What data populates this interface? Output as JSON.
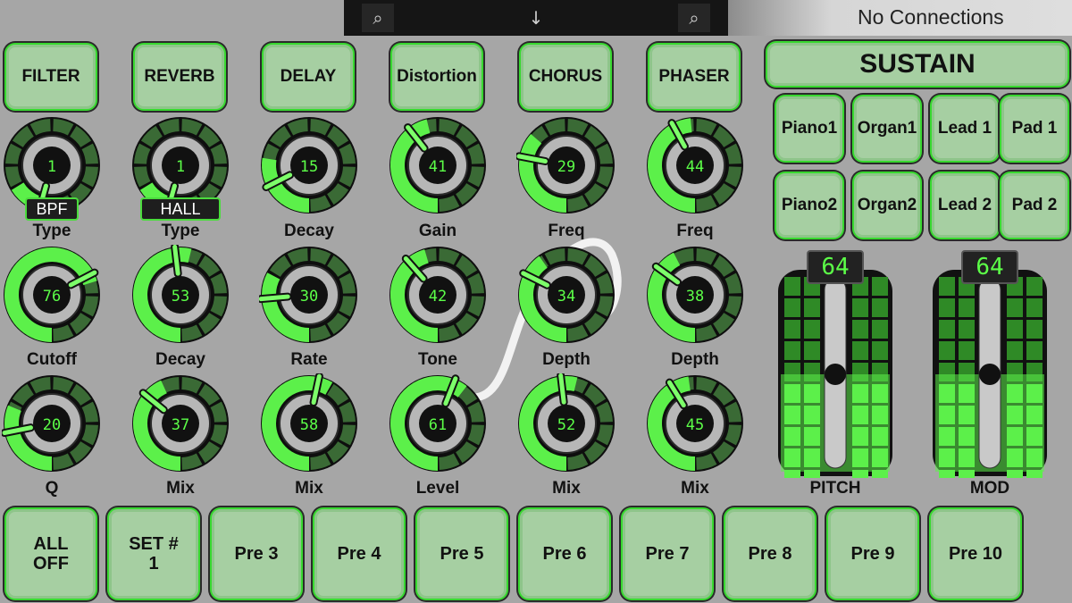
{
  "topbar": {
    "icons": [
      "zoom-icon",
      "download-icon",
      "zoom-icon"
    ],
    "icon_glyphs": [
      "⌕",
      "↓",
      "⌕"
    ],
    "status": "No Connections"
  },
  "fx_buttons": [
    "FILTER",
    "REVERB",
    "DELAY",
    "Distortion",
    "CHORUS",
    "PHASER"
  ],
  "knob_rows": [
    [
      {
        "value": 1,
        "label": "Type",
        "tag": "BPF",
        "level": 0.05
      },
      {
        "value": 1,
        "label": "Type",
        "tag": "HALL",
        "level": 0.05
      },
      {
        "value": 15,
        "label": "Decay",
        "level": 0.2
      },
      {
        "value": 41,
        "label": "Gain",
        "level": 0.45
      },
      {
        "value": 29,
        "label": "Freq",
        "level": 0.32
      },
      {
        "value": 44,
        "label": "Freq",
        "level": 0.48
      }
    ],
    [
      {
        "value": 76,
        "label": "Cutoff",
        "level": 0.77
      },
      {
        "value": 53,
        "label": "Decay",
        "level": 0.55
      },
      {
        "value": 30,
        "label": "Rate",
        "level": 0.27
      },
      {
        "value": 42,
        "label": "Tone",
        "level": 0.44
      },
      {
        "value": 34,
        "label": "Depth",
        "level": 0.37
      },
      {
        "value": 38,
        "label": "Depth",
        "level": 0.4
      }
    ],
    [
      {
        "value": 20,
        "label": "Q",
        "level": 0.25
      },
      {
        "value": 37,
        "label": "Mix",
        "level": 0.41
      },
      {
        "value": 58,
        "label": "Mix",
        "level": 0.61
      },
      {
        "value": 61,
        "label": "Level",
        "level": 0.64
      },
      {
        "value": 52,
        "label": "Mix",
        "level": 0.55
      },
      {
        "value": 45,
        "label": "Mix",
        "level": 0.47
      }
    ]
  ],
  "sustain_label": "SUSTAIN",
  "presets_top": [
    "Piano1",
    "Organ1",
    "Lead 1",
    "Pad 1"
  ],
  "presets_bottom": [
    "Piano2",
    "Organ2",
    "Lead 2",
    "Pad 2"
  ],
  "sliders": [
    {
      "label": "PITCH",
      "value": 64,
      "level": 0.5
    },
    {
      "label": "MOD",
      "value": 64,
      "level": 0.5
    }
  ],
  "bottom_buttons": [
    "ALL OFF",
    "SET # 1",
    "Pre 3",
    "Pre 4",
    "Pre 5",
    "Pre 6",
    "Pre 7",
    "Pre 8",
    "Pre 9",
    "Pre 10"
  ],
  "colors": {
    "accent": "#4dff3a",
    "panel": "#a6a6a6",
    "button": "#a6cfa2",
    "display": "#111111"
  }
}
